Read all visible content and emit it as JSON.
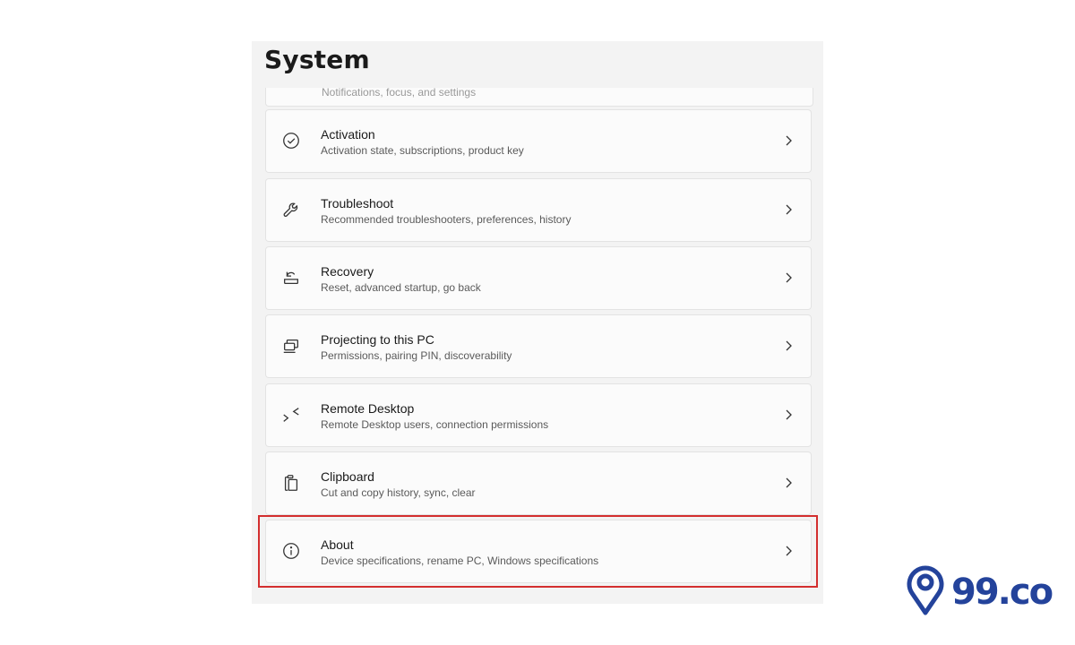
{
  "header": {
    "title": "System"
  },
  "partial_item": {
    "description": "Notifications, focus, and settings"
  },
  "items": [
    {
      "key": "activation",
      "label": "Activation",
      "description": "Activation state, subscriptions, product key",
      "icon": "check-circle-icon"
    },
    {
      "key": "troubleshoot",
      "label": "Troubleshoot",
      "description": "Recommended troubleshooters, preferences, history",
      "icon": "wrench-icon"
    },
    {
      "key": "recovery",
      "label": "Recovery",
      "description": "Reset, advanced startup, go back",
      "icon": "recovery-icon"
    },
    {
      "key": "projecting",
      "label": "Projecting to this PC",
      "description": "Permissions, pairing PIN, discoverability",
      "icon": "projector-icon"
    },
    {
      "key": "remote-desktop",
      "label": "Remote Desktop",
      "description": "Remote Desktop users, connection permissions",
      "icon": "remote-desktop-icon"
    },
    {
      "key": "clipboard",
      "label": "Clipboard",
      "description": "Cut and copy history, sync, clear",
      "icon": "clipboard-icon"
    },
    {
      "key": "about",
      "label": "About",
      "description": "Device specifications, rename PC, Windows specifications",
      "icon": "info-icon"
    }
  ],
  "brand": {
    "name": "99.co",
    "color": "#24439b"
  },
  "highlight_color": "#d32f2f"
}
